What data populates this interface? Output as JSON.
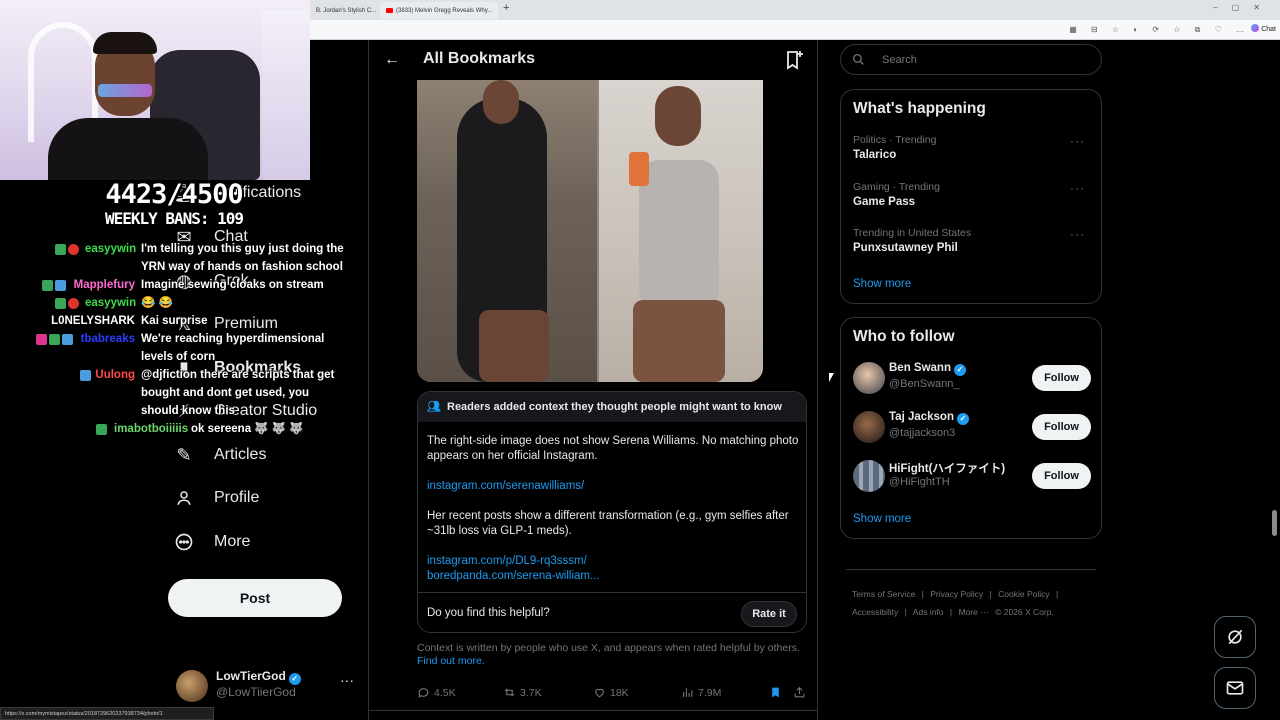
{
  "browser": {
    "tabs": [
      {
        "label": "B. Jordan's Stylish C..."
      },
      {
        "label": "(3833) Melvin Gregg Reveals Why..."
      }
    ],
    "chat_label": "Chat",
    "status_url": "https://x.com/mymixtapez/status/2018729620237938734/photo/1"
  },
  "stream_overlay": {
    "counter": "4423/4500",
    "weekly_bans": "WEEKLY BANS: 109",
    "chat": [
      {
        "user": "easyywin",
        "user_color": "#3cdc4a",
        "message": "I'm telling you this guy just doing the YRN way of hands on fashion school"
      },
      {
        "user": "Mapplefury",
        "user_color": "#ff6bd2",
        "message": "Imagine sewing cloaks on stream"
      },
      {
        "user": "easyywin",
        "user_color": "#3cdc4a",
        "message": "😂 😂"
      },
      {
        "user": "L0NELYSHARK",
        "user_color": "#ffffff",
        "message": "Kai surprise"
      },
      {
        "user": "tbabreaks",
        "user_color": "#2b3dff",
        "message": "We're reaching hyperdimensional levels of corn"
      },
      {
        "user": "Uulong",
        "user_color": "#ff4a4a",
        "message": "@djfiction there are scripts that get bought and dont get used, you should know this"
      },
      {
        "user": "imabotboiiiiis",
        "user_color": "#6bd66b",
        "message": "ok sereena 🐺 🐺 🐺"
      }
    ]
  },
  "sidebar": {
    "items": [
      {
        "label": "Notifications",
        "icon": "bell-icon"
      },
      {
        "label": "Chat",
        "icon": "mail-icon"
      },
      {
        "label": "Grok",
        "icon": "grok-icon"
      },
      {
        "label": "Premium",
        "icon": "x-logo-icon"
      },
      {
        "label": "Bookmarks",
        "icon": "bookmark-icon"
      },
      {
        "label": "Creator Studio",
        "icon": "lightning-icon"
      },
      {
        "label": "Articles",
        "icon": "article-icon"
      },
      {
        "label": "Profile",
        "icon": "person-icon"
      },
      {
        "label": "More",
        "icon": "more-circle-icon"
      }
    ],
    "post_label": "Post",
    "account": {
      "name": "LowTierGod",
      "handle": "@LowTiierGod"
    }
  },
  "main": {
    "title": "All Bookmarks",
    "note": {
      "header": "Readers added context they thought people might want to know",
      "para1": "The right-side image does not show Serena Williams. No matching photo appears on her official Instagram.",
      "link1": "instagram.com/serenawilliams/",
      "para2": "Her recent posts show a different transformation (e.g., gym selfies after ~31lb loss via GLP-1 meds).",
      "link2": "instagram.com/p/DL9-rq3sssm/",
      "link3": "boredpanda.com/serena-william...",
      "helpful_question": "Do you find this helpful?",
      "rate_label": "Rate it"
    },
    "context_text": "Context is written by people who use X, and appears when rated helpful by others.",
    "find_out_more": "Find out more.",
    "actions": {
      "replies": "4.5K",
      "reposts": "3.7K",
      "likes": "18K",
      "views": "7.9M"
    }
  },
  "right": {
    "search_placeholder": "Search",
    "whats_happening": {
      "title": "What's happening",
      "trends": [
        {
          "meta": "Politics · Trending",
          "name": "Talarico"
        },
        {
          "meta": "Gaming · Trending",
          "name": "Game Pass"
        },
        {
          "meta": "Trending in United States",
          "name": "Punxsutawney Phil"
        }
      ],
      "show_more": "Show more"
    },
    "who_to_follow": {
      "title": "Who to follow",
      "accounts": [
        {
          "name": "Ben Swann",
          "handle": "@BenSwann_",
          "verified": true
        },
        {
          "name": "Taj Jackson",
          "handle": "@tajjackson3",
          "verified": true
        },
        {
          "name": "HiFight(ハイファイト)",
          "handle": "@HiFightTH",
          "verified": false
        }
      ],
      "follow_label": "Follow",
      "show_more": "Show more"
    },
    "footer": {
      "links": [
        "Terms of Service",
        "|",
        "Privacy Policy",
        "|",
        "Cookie Policy",
        "|",
        "Accessibility",
        "|",
        "Ads info",
        "|",
        "More ···"
      ],
      "copyright": "© 2026 X Corp."
    }
  }
}
